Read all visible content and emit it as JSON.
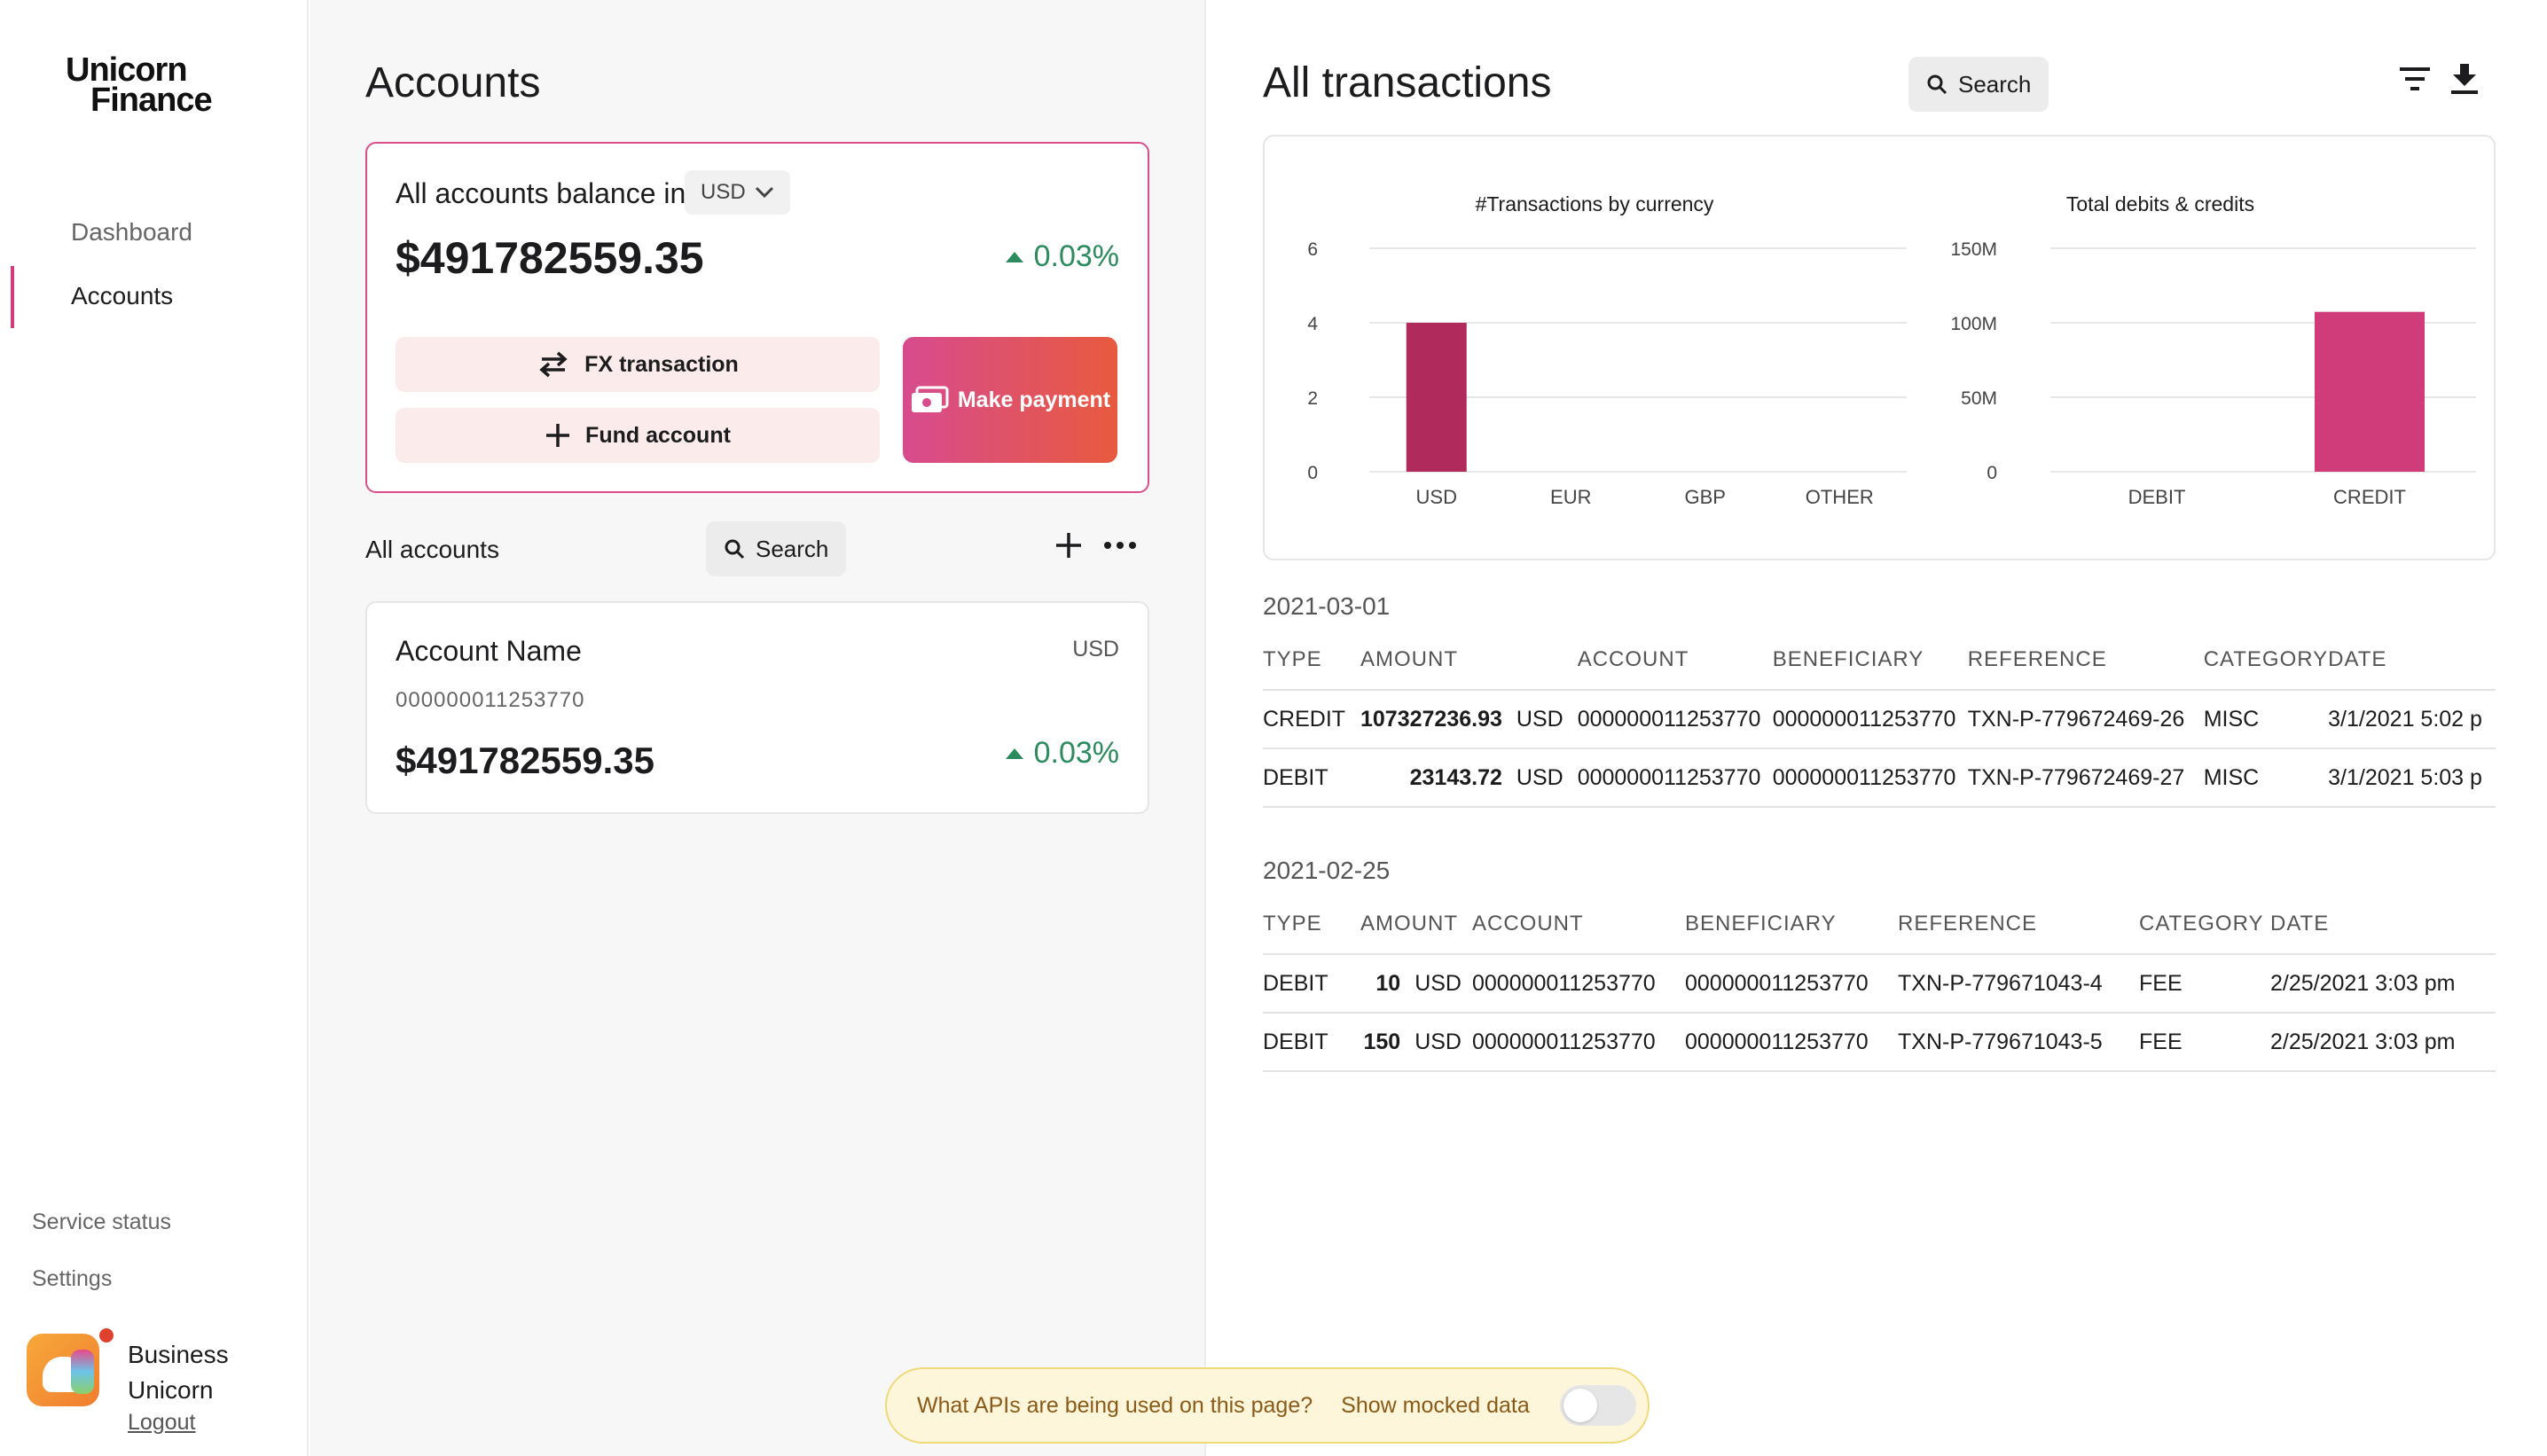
{
  "brand": {
    "line1": "Unicorn",
    "line2": "Finance"
  },
  "sidebar": {
    "items": [
      {
        "label": "Dashboard",
        "active": false
      },
      {
        "label": "Accounts",
        "active": true
      }
    ],
    "footer": {
      "service_status": "Service status",
      "settings": "Settings"
    },
    "user": {
      "name": "Business Unicorn",
      "logout": "Logout"
    }
  },
  "accounts": {
    "title": "Accounts",
    "balance_card": {
      "label": "All accounts balance in",
      "currency": "USD",
      "amount": "$491782559.35",
      "change": "0.03%",
      "fx_button": "FX transaction",
      "fund_button": "Fund account",
      "pay_button": "Make payment"
    },
    "list": {
      "label": "All accounts",
      "search": "Search",
      "items": [
        {
          "name": "Account Name",
          "number": "000000011253770",
          "currency": "USD",
          "balance": "$491782559.35",
          "change": "0.03%"
        }
      ]
    }
  },
  "transactions": {
    "title": "All transactions",
    "search": "Search",
    "chart_data": [
      {
        "type": "bar",
        "title": "#Transactions by currency",
        "categories": [
          "USD",
          "EUR",
          "GBP",
          "OTHER"
        ],
        "values": [
          4,
          0,
          0,
          0
        ],
        "yticks": [
          "0",
          "2",
          "4",
          "6"
        ],
        "ylim": [
          0,
          6
        ],
        "color": "#b02a5b"
      },
      {
        "type": "bar",
        "title": "Total debits & credits",
        "categories": [
          "DEBIT",
          "CREDIT"
        ],
        "values": [
          23143.72,
          107327236.93
        ],
        "yticks": [
          "0",
          "50M",
          "100M",
          "150M"
        ],
        "ylim": [
          0,
          150000000
        ],
        "color": "#cf3c79"
      }
    ],
    "groups": [
      {
        "date": "2021-03-01",
        "headers": [
          "TYPE",
          "AMOUNT",
          "ACCOUNT",
          "BENEFICIARY",
          "REFERENCE",
          "CATEGORY",
          "DATE"
        ],
        "rows": [
          {
            "type": "CREDIT",
            "amount": "107327236.93",
            "currency": "USD",
            "account": "000000011253770",
            "beneficiary": "000000011253770",
            "reference": "TXN-P-779672469-26",
            "category": "MISC",
            "date": "3/1/2021 5:02 p"
          },
          {
            "type": "DEBIT",
            "amount": "23143.72",
            "currency": "USD",
            "account": "000000011253770",
            "beneficiary": "000000011253770",
            "reference": "TXN-P-779672469-27",
            "category": "MISC",
            "date": "3/1/2021 5:03 p"
          }
        ]
      },
      {
        "date": "2021-02-25",
        "headers": [
          "TYPE",
          "AMOUNT",
          "ACCOUNT",
          "BENEFICIARY",
          "REFERENCE",
          "CATEGORY",
          "DATE"
        ],
        "rows": [
          {
            "type": "DEBIT",
            "amount": "10",
            "currency": "USD",
            "account": "000000011253770",
            "beneficiary": "000000011253770",
            "reference": "TXN-P-779671043-4",
            "category": "FEE",
            "date": "2/25/2021 3:03 pm"
          },
          {
            "type": "DEBIT",
            "amount": "150",
            "currency": "USD",
            "account": "000000011253770",
            "beneficiary": "000000011253770",
            "reference": "TXN-P-779671043-5",
            "category": "FEE",
            "date": "2/25/2021 3:03 pm"
          }
        ]
      }
    ]
  },
  "banner": {
    "question": "What APIs are being used on this page?",
    "toggle_label": "Show mocked data",
    "toggle_on": false
  },
  "colors": {
    "accent": "#d23c78",
    "positive": "#2c8b5c",
    "banner_bg": "#fdf6da",
    "banner_text": "#8a5a18"
  }
}
